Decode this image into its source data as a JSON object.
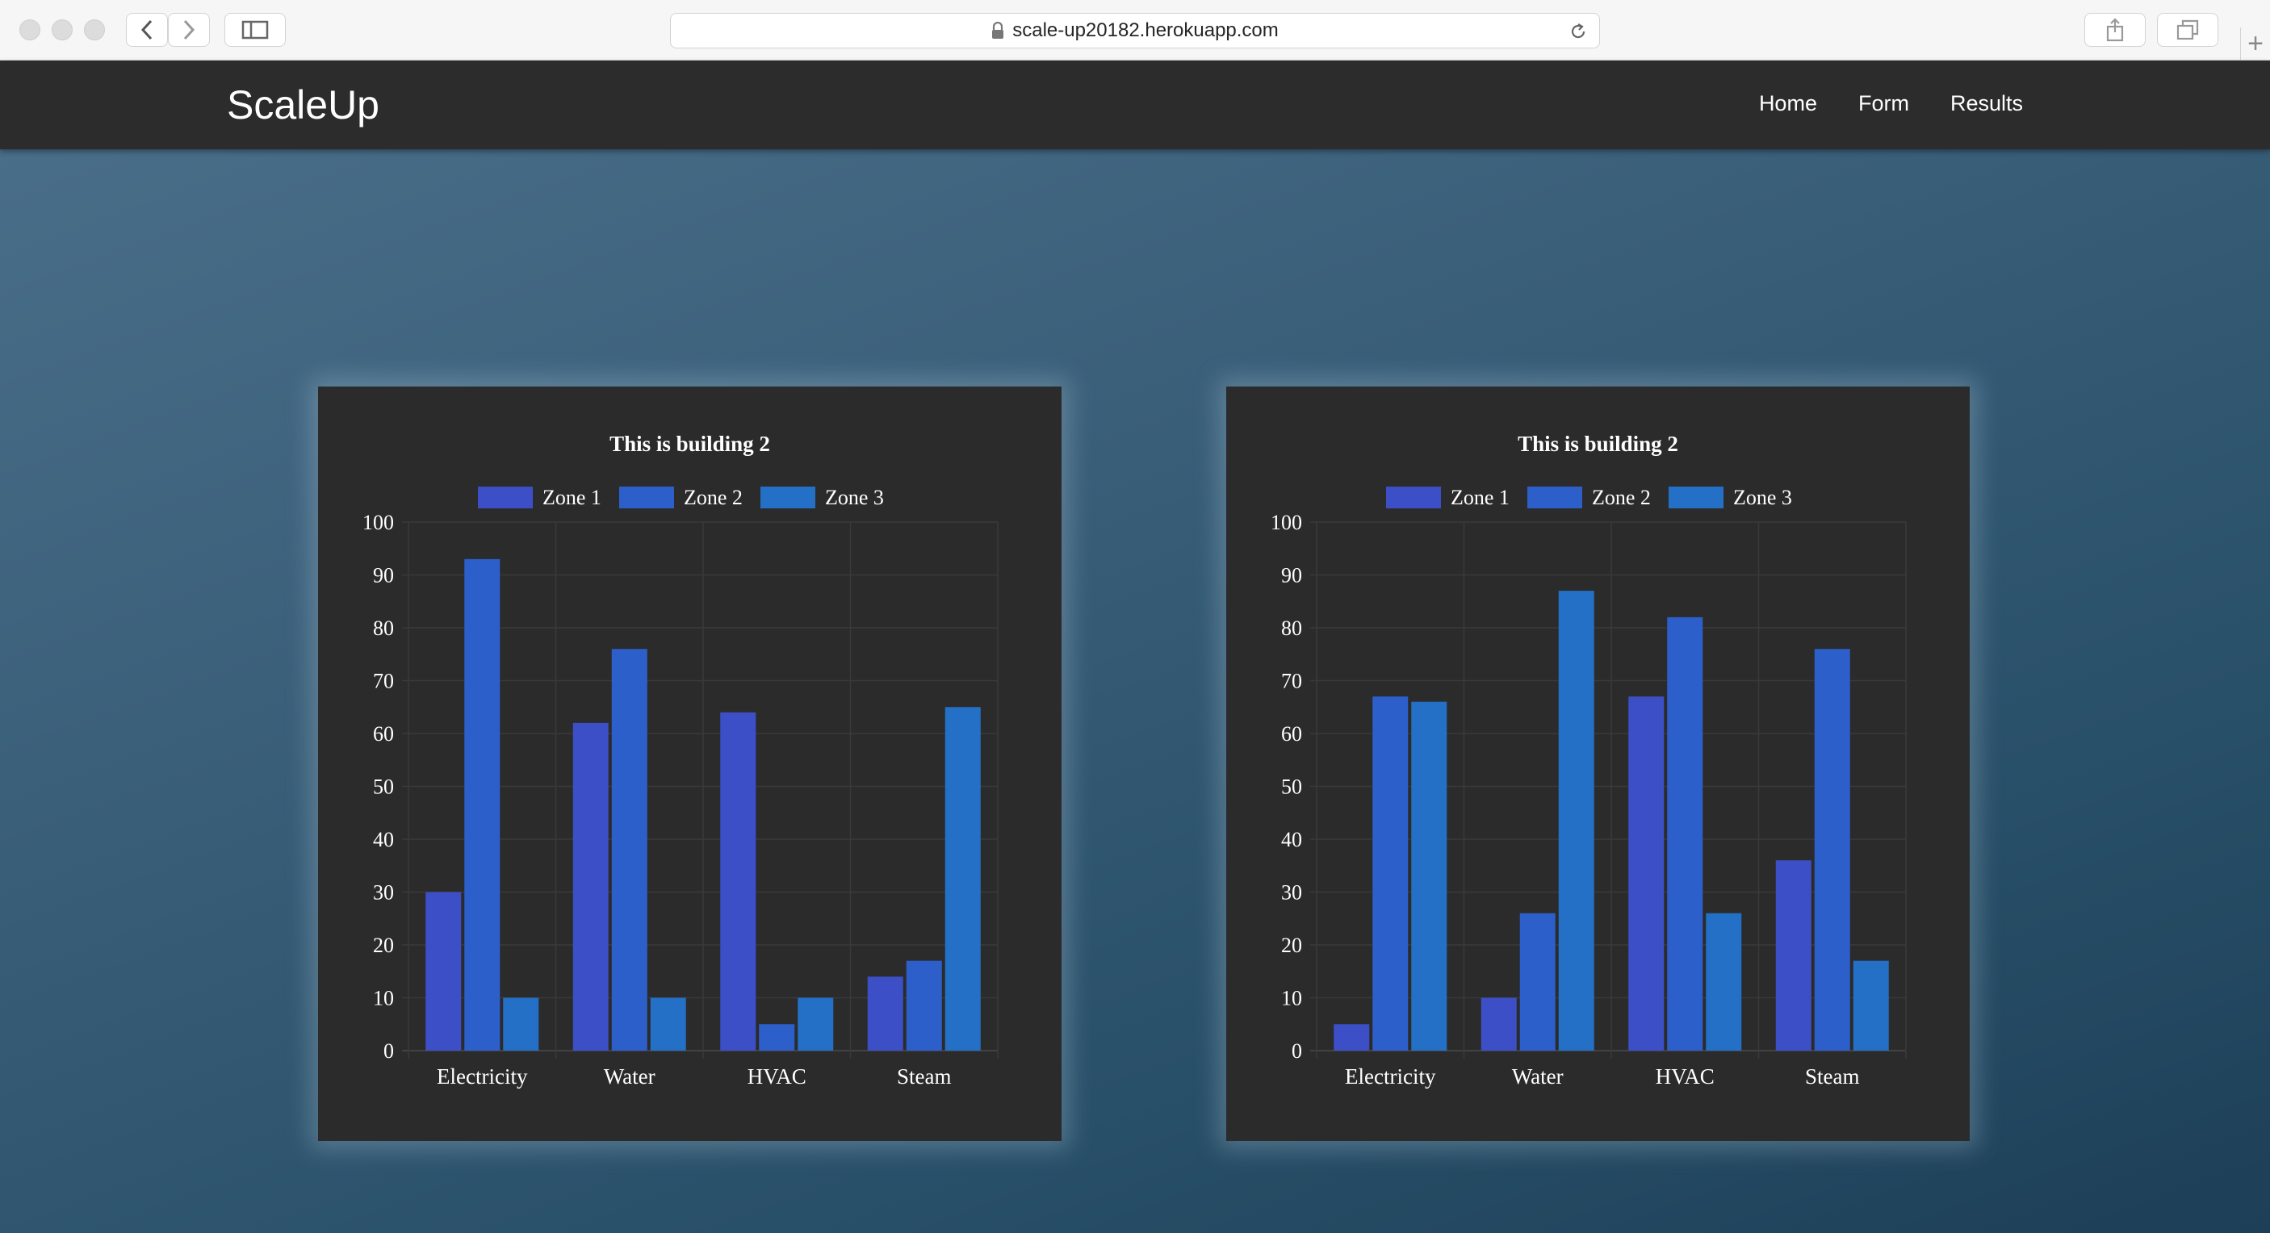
{
  "browser": {
    "url": "scale-up20182.herokuapp.com",
    "icons": [
      "back-icon",
      "forward-icon",
      "sidebar-icon",
      "lock-icon",
      "reload-icon",
      "share-icon",
      "tabs-icon",
      "new-tab-icon"
    ]
  },
  "navbar": {
    "brand": "ScaleUp",
    "links": [
      "Home",
      "Form",
      "Results"
    ]
  },
  "colors": {
    "zone1": "#3d4fc6",
    "zone2": "#2d5fcb",
    "zone3": "#2470c6",
    "card_bg": "#2b2b2b",
    "navbar_bg": "#2c2c2c"
  },
  "chart_data": [
    {
      "type": "bar",
      "title": "This is building 2",
      "categories": [
        "Electricity",
        "Water",
        "HVAC",
        "Steam"
      ],
      "series": [
        {
          "name": "Zone 1",
          "values": [
            30,
            62,
            64,
            14
          ]
        },
        {
          "name": "Zone 2",
          "values": [
            93,
            76,
            5,
            17
          ]
        },
        {
          "name": "Zone 3",
          "values": [
            10,
            10,
            10,
            65
          ]
        }
      ],
      "ylim": [
        0,
        100
      ],
      "yticks": [
        0,
        10,
        20,
        30,
        40,
        50,
        60,
        70,
        80,
        90,
        100
      ],
      "legend": "top",
      "grid": true
    },
    {
      "type": "bar",
      "title": "This is building 2",
      "categories": [
        "Electricity",
        "Water",
        "HVAC",
        "Steam"
      ],
      "series": [
        {
          "name": "Zone 1",
          "values": [
            5,
            10,
            67,
            36
          ]
        },
        {
          "name": "Zone 2",
          "values": [
            67,
            26,
            82,
            76
          ]
        },
        {
          "name": "Zone 3",
          "values": [
            66,
            87,
            26,
            17
          ]
        }
      ],
      "ylim": [
        0,
        100
      ],
      "yticks": [
        0,
        10,
        20,
        30,
        40,
        50,
        60,
        70,
        80,
        90,
        100
      ],
      "legend": "top",
      "grid": true
    }
  ]
}
